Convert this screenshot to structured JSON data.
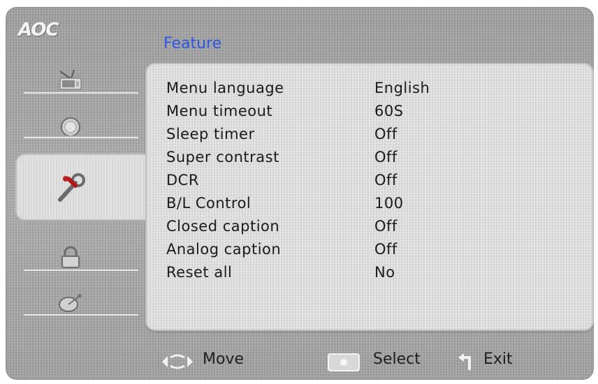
{
  "brand": {
    "logo_text": "AOC"
  },
  "header": {
    "title": "Feature",
    "title_color": "#2e56e6"
  },
  "sidebar": {
    "items": [
      {
        "icon": "tv-antenna-icon",
        "active": false
      },
      {
        "icon": "picture-icon",
        "active": false
      },
      {
        "icon": "tools-wrench-icon",
        "active": true
      },
      {
        "icon": "lock-icon",
        "active": false
      },
      {
        "icon": "satellite-dish-icon",
        "active": false
      }
    ]
  },
  "menu": {
    "rows": [
      {
        "label": "Menu language",
        "value": "English"
      },
      {
        "label": "Menu timeout",
        "value": "60S"
      },
      {
        "label": "Sleep timer",
        "value": "Off"
      },
      {
        "label": "Super contrast",
        "value": "Off"
      },
      {
        "label": "DCR",
        "value": "Off"
      },
      {
        "label": "B/L Control",
        "value": "100"
      },
      {
        "label": "Closed caption",
        "value": "Off"
      },
      {
        "label": "Analog caption",
        "value": "Off"
      },
      {
        "label": "Reset all",
        "value": "No"
      }
    ]
  },
  "footer": {
    "move_label": "Move",
    "select_label": "Select",
    "exit_label": "Exit"
  },
  "colors": {
    "background": "#a5a5a5",
    "panel": "#dedede",
    "text": "#1a1a1a"
  }
}
